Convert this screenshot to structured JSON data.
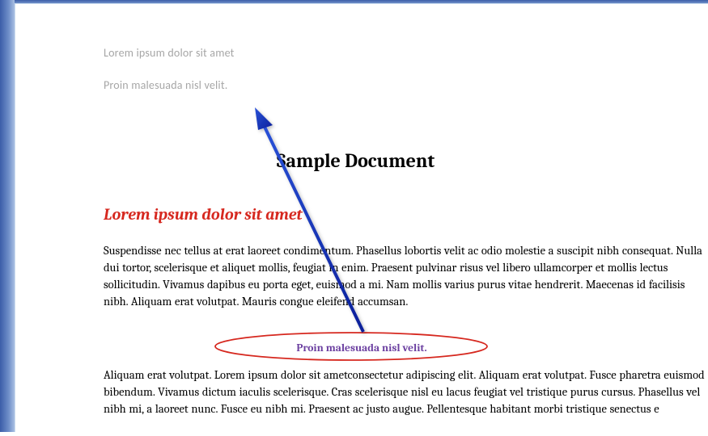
{
  "header": {
    "line1": "Lorem ipsum dolor sit amet",
    "line2": "Proin malesuada nisl velit."
  },
  "title": "Sample Document",
  "subtitle": "Lorem ipsum dolor sit amet",
  "paragraph1": "Suspendisse nec tellus at erat laoreet condimentum. Phasellus lobortis velit ac odio molestie a suscipit nibh consequat. Nulla dui tortor, scelerisque et aliquet mollis, feugiat in enim. Praesent  pulvinar risus vel libero ullamcorper et mollis lectus sollicitudin. Vivamus dapibus eu porta eget, euismod a mi. Nam mollis varius purus vitae hendrerit. Maecenas id facilisis  nibh. Aliquam erat volutpat. Mauris congue eleifend  accumsan.",
  "callout": "Proin malesuada nisl velit.",
  "paragraph2": "Aliquam erat volutpat. Lorem ipsum dolor sit ametconsectetur adipiscing elit.  Aliquam erat volutpat. Fusce pharetra euismod bibendum. Vivamus dictum iaculis scelerisque. Cras scelerisque nisl  eu lacus feugiat vel tristique purus cursus. Phasellus vel nibh mi, a laoreet nunc. Fusce eu nibh mi.  Praesent ac justo augue. Pellentesque habitant morbi tristique senectus e",
  "colors": {
    "chrome": "#6f8fc9",
    "header_text": "#a6a6a6",
    "subtitle": "#d6281f",
    "callout_text": "#6b3fa0",
    "oval_stroke": "#d6281f",
    "arrow": "#1a3fd1"
  }
}
